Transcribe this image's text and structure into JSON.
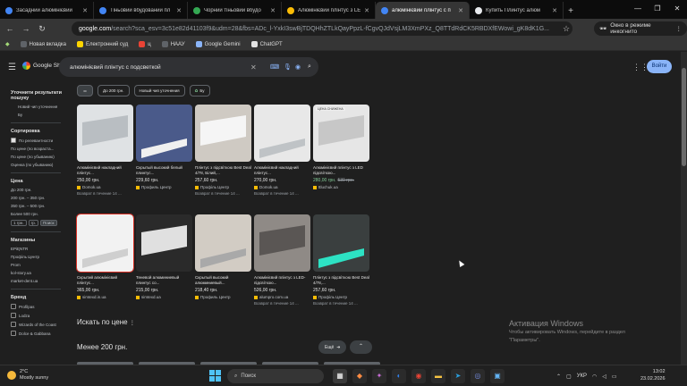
{
  "tabs": [
    {
      "title": "Засадний алюмінієвий",
      "color": "#4285f4",
      "active": false
    },
    {
      "title": "Тіньовий вбудований пл",
      "color": "#4285f4",
      "active": false
    },
    {
      "title": "Чорний тіньовий вбудо",
      "color": "#34a853",
      "active": false
    },
    {
      "title": "Алюмінієвий плінтус з LED",
      "color": "#fbbc05",
      "active": false
    },
    {
      "title": "алюмінієвий плінтус с п",
      "color": "#4285f4",
      "active": true
    },
    {
      "title": "Купить Плинтус алюм",
      "color": "#e8eaed",
      "active": false
    }
  ],
  "new_tab_symbol": "+",
  "window_controls": [
    "—",
    "❐",
    "✕"
  ],
  "url": {
    "host": "google.com",
    "path": "/search?sca_esv=3c51e82d41103f9&udm=28&fbs=ADc_l-YxkI3swBjTDQHhZTLkQayPpzL-fCgvQJdVsjLM3XmPXz_Q8TTdRdCK5RBDXfEWowi_gK8dK1G..."
  },
  "incognito_label": "Окно в режиме инкогнито",
  "bookmarks": [
    {
      "label": "Новая вкладка",
      "color": "#5f6368"
    },
    {
      "label": "Електронний суд",
      "color": "#ffd500"
    },
    {
      "label": "ц",
      "color": "#ea4335"
    },
    {
      "label": "НААУ",
      "color": "#5f6368"
    },
    {
      "label": "Google Gemini",
      "color": "#8ab4f8"
    },
    {
      "label": "ChatGPT",
      "color": "#e3e3e3"
    }
  ],
  "header": {
    "logo_text": "Google Shopping",
    "search_value": "алюмінієвий плінтус с подсветкой",
    "login_label": "Войти"
  },
  "sidebar": {
    "refine_title": "Уточнити результати пошуку",
    "refine_items": [
      "Новий чип уточнення",
      "Бу"
    ],
    "sort_title": "Сортировка",
    "sort_items": [
      {
        "label": "По релевантности",
        "checked": true
      },
      {
        "label": "По цене (по возраста...",
        "checked": false
      },
      {
        "label": "По цене (по убыванию)",
        "checked": false
      },
      {
        "label": "Оценка (по убыванию)",
        "checked": false
      }
    ],
    "price_title": "Цена",
    "price_items": [
      "До 200 грн.",
      "200 грн. – 350 грн.",
      "350 грн. – 500 грн.",
      "Более 500 грн."
    ],
    "price_from": "1 грн.",
    "price_to": "гр.",
    "price_go": "Поиск",
    "stores_title": "Магазины",
    "stores": [
      "EPiĘNTR",
      "Профіль Центр",
      "Prom",
      "kol-story.ua",
      "market-dent.ua"
    ],
    "brand_title": "Бренд",
    "brands": [
      "Profilpas",
      "Lodza",
      "Wizards of the Coast",
      "Dolce & Gabbana"
    ]
  },
  "chips": [
    "До 200 грн.",
    "Новый чип уточнения",
    "Бу"
  ],
  "products": [
    {
      "title": "Алюмінієвий накладний плінтус...",
      "price": "250,00 грн.",
      "old": "",
      "store": "Domok.ua",
      "note": "Возврат в течение 14 ...",
      "bg": "#dfe2e4",
      "shape": "#b9bec2",
      "badge": ""
    },
    {
      "title": "Скрытый высокий белый плинтус...",
      "price": "229,60 грн.",
      "old": "",
      "store": "Профиль Центр",
      "note": "",
      "bg": "#4a5a8a",
      "shape": "#f0f0f0",
      "badge": ""
    },
    {
      "title": "Плінтус з підсвіткою Best Deal 4/78, Білий,...",
      "price": "257,60 грн.",
      "old": "",
      "store": "Профіль Центр",
      "note": "Возврат в течение 14 ...",
      "bg": "#cfcac3",
      "shape": "#f5f5f5",
      "badge": ""
    },
    {
      "title": "Алюмінієвий накладний плінтус...",
      "price": "270,00 грн.",
      "old": "",
      "store": "Domok.ua",
      "note": "Возврат в течение 14 ...",
      "bg": "#e8e8e8",
      "shape": "#bfc3c6",
      "badge": ""
    },
    {
      "title": "Алюмінієвий плінтус з LED підсвіткою...",
      "price": "280,00 грн.",
      "old": "530 грн.",
      "store": "ttluchuk.ua",
      "note": "",
      "bg": "#e6e6e6",
      "shape": "#c7c7c7",
      "badge": "ЦЕНА СНИЖЕНА"
    },
    {
      "title": "Скрытий алюмінієвий плінтус...",
      "price": "365,00 грн.",
      "old": "",
      "store": "simtexd.in.ua",
      "note": "",
      "bg": "#f2f2f2",
      "shape": "#cfcfcf",
      "badge": ""
    },
    {
      "title": "Теневой алюминиевый плинтус со...",
      "price": "215,00 грн.",
      "old": "",
      "store": "simtexd.ua",
      "note": "",
      "bg": "#2a2a2a",
      "shape": "#e0e0e0",
      "badge": ""
    },
    {
      "title": "Скрытый высокий алюминиевый...",
      "price": "218,40 грн.",
      "old": "",
      "store": "Профиль Центр",
      "note": "",
      "bg": "#d2ccc4",
      "shape": "#a9a9a9",
      "badge": ""
    },
    {
      "title": "Алюмінієвий плінтус з LED-підсвіткою...",
      "price": "526,00 грн.",
      "old": "",
      "store": "alumpro.com.ua",
      "note": "Возврат в течение 14 ...",
      "bg": "#8f8a86",
      "shape": "#5a5654",
      "badge": ""
    },
    {
      "title": "Плінтус з підсвіткою Best Deal 4/78,...",
      "price": "257,60 грн.",
      "old": "",
      "store": "Профіль Центр",
      "note": "Возврат в течение 14 ...",
      "bg": "#3a3f3f",
      "shape": "#2de2c4",
      "badge": ""
    }
  ],
  "section_price": "Искать по цене",
  "section_under": "Менее 200 грн.",
  "next_label": "Ещё",
  "watermark": {
    "title": "Активация Windows",
    "sub1": "Чтобы активировать Windows, перейдите в раздел",
    "sub2": "\"Параметры\"."
  },
  "taskbar": {
    "temp": "2°C",
    "weather": "Mostly sunny",
    "search_placeholder": "Поиск",
    "lang": "УКР",
    "time": "13:02",
    "date": "23.02.2026"
  }
}
